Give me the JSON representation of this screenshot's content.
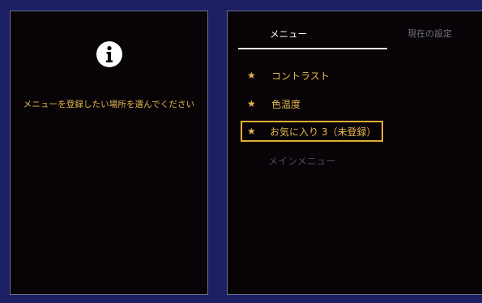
{
  "left_panel": {
    "icon": "info-icon",
    "message": "メニューを登録したい場所を選んでください"
  },
  "right_panel": {
    "tabs": [
      {
        "label": "メニュー",
        "active": true
      },
      {
        "label": "現在の設定",
        "active": false
      }
    ],
    "items": [
      {
        "icon": "star-icon",
        "label": "コントラスト"
      },
      {
        "icon": "star-icon",
        "label": "色温度"
      },
      {
        "icon": "star-icon",
        "label": "お気に入り 3（未登録）",
        "selected": true
      },
      {
        "label": "メインメニュー"
      }
    ]
  },
  "colors": {
    "background": "#1c1f62",
    "panel": "#070306",
    "accent": "#e7b84e",
    "disabled_text": "#4c4c5c"
  }
}
